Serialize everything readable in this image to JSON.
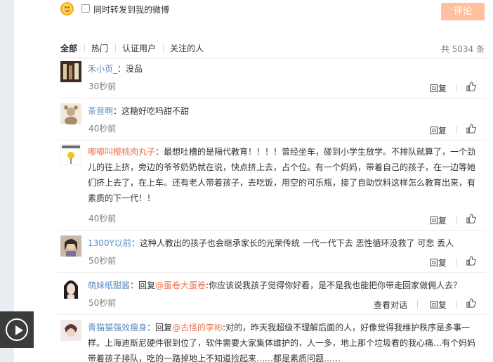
{
  "compose": {
    "forward_label": "同时转发到我的微博",
    "comment_button": "评论"
  },
  "tabs": [
    {
      "label": "全部",
      "active": true
    },
    {
      "label": "热门",
      "active": false
    },
    {
      "label": "认证用户",
      "active": false
    },
    {
      "label": "关注的人",
      "active": false
    }
  ],
  "total": "共 5034 条",
  "comments": [
    {
      "user": "禾小页_",
      "sep": "：",
      "mention": "",
      "text": "没品",
      "time": "30秒前",
      "actions": [
        "",
        "回复"
      ]
    },
    {
      "user": "茶音啊",
      "sep": "：",
      "mention": "",
      "text": "这糖好吃吗甜不甜",
      "time": "40秒前",
      "actions": [
        "",
        "回复"
      ]
    },
    {
      "user": "嘟嘟叫樱桃肉丸子",
      "sep": "：",
      "mention": "",
      "text": "最想吐槽的是隔代教育！！！！曾经坐车，碰到小学生放学。不排队就算了，一个劲儿的往上挤，旁边的爷爷奶奶就在说，快点挤上去，占个位。有一个妈妈，带着自己的孩子，在一边等她们挤上去了，在上车。还有老人带着孩子，去吃饭，用空的可乐瓶，接了自助饮料这样怎么教育出来，有素质的下一代！！",
      "time": "40秒前",
      "actions": [
        "",
        "回复"
      ]
    },
    {
      "user": "1300Y以前",
      "sep": "：",
      "mention": "",
      "text": "这种人教出的孩子也会继承家长的光荣传统 一代一代下去 恶性循环没救了 可悲 丢人",
      "time": "50秒前",
      "actions": [
        "",
        "回复"
      ]
    },
    {
      "user": "萌妹纸甜酱",
      "sep": "：回复",
      "mention": "@蛋卷大蛋卷",
      "text": ":你应该说我孩子觉得你好看，是不是我也能把你带走回家做佣人去？",
      "time": "50秒前",
      "actions": [
        "查看对话",
        "回复"
      ]
    },
    {
      "user": "青猫猫强效瘦身",
      "sep": "：回复",
      "mention": "@古怪的李彬",
      "text": ":对的，昨天我超级不理解后面的人，好像觉得我维护秩序是多事一样。上海迪斯尼硬件很到位了，软件需要大家集体维护的，人一多，地上那个垃圾看的我心痛…有个妈妈带着孩子排队，吃的一路掉地上不知道捡起来……都是素质问题……",
      "time": "",
      "actions": [
        "",
        ""
      ]
    }
  ],
  "icons": {
    "emoji": "smile-icon",
    "like": "thumbs-up-icon",
    "play": "play-icon"
  },
  "colors": {
    "accent": "#eb7350",
    "link": "#5a8ac0",
    "button": "#ffc09f"
  }
}
